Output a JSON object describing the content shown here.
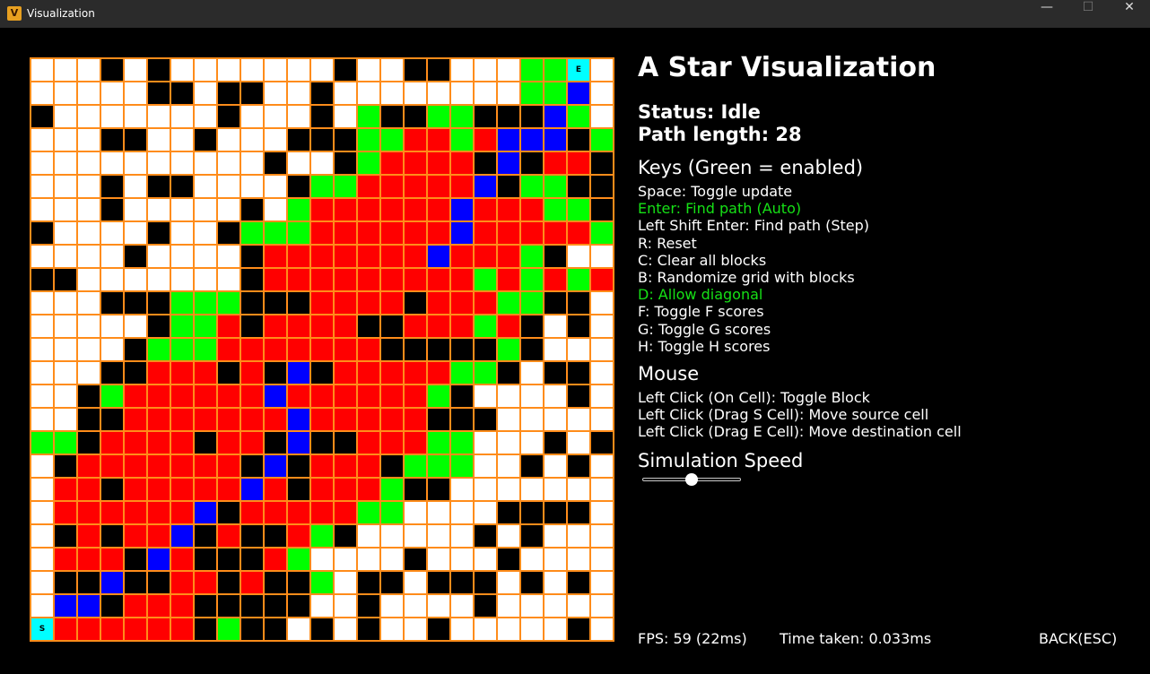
{
  "window": {
    "title": "Visualization",
    "icon_letter": "V",
    "minimize": "—",
    "maximize": "☐",
    "close": "✕"
  },
  "grid": {
    "legend": {
      "w": "empty",
      "b": "block",
      "r": "closed",
      "g": "open",
      "u": "path",
      "s": "source",
      "e": "destination",
      "y": "current"
    },
    "rows": [
      "wwwbwbwwwwwwwbwwbbwwwgge",
      "wwwwwbbwbbwwbwwwwwwwwggu",
      "bwwwwwwwbwwwbwgbbggbbbug",
      "wwwbbwwbwwwbbbggrrgruuubg",
      "wwwwwwwwwwbwwbgrrrrbubrrbbb",
      "wwwbwbbwwwwbggrrrrrubggbb",
      "wwwbwwwwwbwgrrrrrrurrrggb",
      "bwwwwbwwbgggrrrrrrurrrrrgbb",
      "wwwwbwwwwbrrrrrrrurrrgbw",
      "bbwwwwwwwbrrrrrrrrrgrgrgrbw",
      "wwwbbbgggbbbrrrrbrrrggbbw",
      "wwwwwbggrbrrrrbbrrrgrbwbw",
      "wwwwbgggrrrrrrrbbbbbgbwww",
      "wwwbbrrrbrbubrrrrrggbwbbw",
      "wwbgrrrrrrurrrrrrgbwwwwbw",
      "wwbbrrrrrrrurrrrrbbbwwwww",
      "ggbrrrrbrrbubbrrrggwwwbwb",
      "wbrrrrrrrbubrrrbgggwwbwbw",
      "wrrbrrrrrurbrrrgbbwwwwwww",
      "wrrrrrrubrrrrrggwwwwbbbbw",
      "wbrbrrubrbbrgbwwwwwbwbwww",
      "wrrrburbbbrgwwwwbwwwbwwww",
      "wbbubbrrbrbbgwbbwbbbwbwbw",
      "wuubrrrbbbbbwwbwwwwbwwwww",
      "srrrrrrbgbbwbwbwwbwwwwwbw"
    ]
  },
  "panel": {
    "title": "A Star Visualization",
    "status": "Status: Idle",
    "path_length": "Path length: 28",
    "keys_heading": "Keys (Green = enabled)",
    "keys": [
      {
        "text": "Space: Toggle update",
        "enabled": false
      },
      {
        "text": "Enter: Find path (Auto)",
        "enabled": true
      },
      {
        "text": "Left Shift Enter: Find path (Step)",
        "enabled": false
      },
      {
        "text": "R: Reset",
        "enabled": false
      },
      {
        "text": "C: Clear all blocks",
        "enabled": false
      },
      {
        "text": "B: Randomize grid with blocks",
        "enabled": false
      },
      {
        "text": "D: Allow diagonal",
        "enabled": true
      },
      {
        "text": "F: Toggle F scores",
        "enabled": false
      },
      {
        "text": "G: Toggle G scores",
        "enabled": false
      },
      {
        "text": "H: Toggle H scores",
        "enabled": false
      }
    ],
    "mouse_heading": "Mouse",
    "mouse": [
      "Left Click (On Cell): Toggle Block",
      "Left Click (Drag S Cell): Move source cell",
      "Left Click (Drag E Cell): Move destination cell"
    ],
    "speed_heading": "Simulation Speed",
    "speed_value": 0.5
  },
  "footer": {
    "fps": "FPS: 59 (22ms)",
    "time_taken": "Time taken: 0.033ms",
    "back": "BACK(ESC)"
  },
  "colors": {
    "empty": "#ffffff",
    "block": "#000000",
    "closed": "#ff0000",
    "open": "#00ff00",
    "path": "#0000ff",
    "endpoint": "#00ffff",
    "grid_lines": "#ff8c1a",
    "current_outline": "#ffd700",
    "enabled_key": "#16e016"
  }
}
